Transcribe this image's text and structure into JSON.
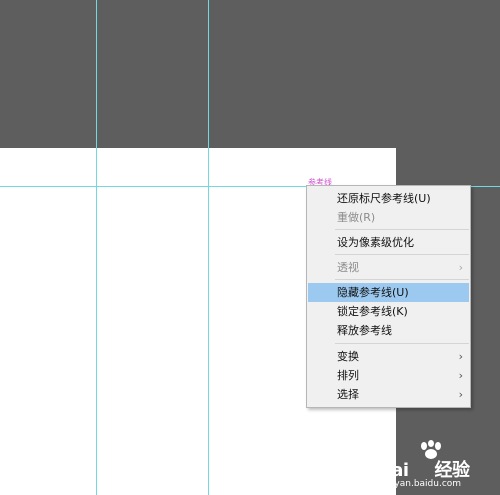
{
  "guide_label": "参考线",
  "context_menu": {
    "items": [
      {
        "label": "还原标尺参考线(U)",
        "enabled": true
      },
      {
        "label": "重做(R)",
        "enabled": false
      },
      {
        "label": "设为像素级优化",
        "enabled": true
      },
      {
        "label": "透视",
        "enabled": false,
        "submenu": true
      },
      {
        "label": "隐藏参考线(U)",
        "enabled": true,
        "highlighted": true
      },
      {
        "label": "锁定参考线(K)",
        "enabled": true
      },
      {
        "label": "释放参考线",
        "enabled": true
      },
      {
        "label": "变换",
        "enabled": true,
        "submenu": true
      },
      {
        "label": "排列",
        "enabled": true,
        "submenu": true
      },
      {
        "label": "选择",
        "enabled": true,
        "submenu": true
      }
    ],
    "submenu_arrow": "›"
  },
  "watermark": {
    "brand_left": "Bai",
    "brand_right": "经验",
    "url": "jingyan.baidu.com"
  },
  "colors": {
    "pasteboard": "#5e5e5e",
    "artboard": "#ffffff",
    "guide": "#73d8e0",
    "guide_label": "#d24fd2",
    "highlight": "#9cc9f0"
  }
}
